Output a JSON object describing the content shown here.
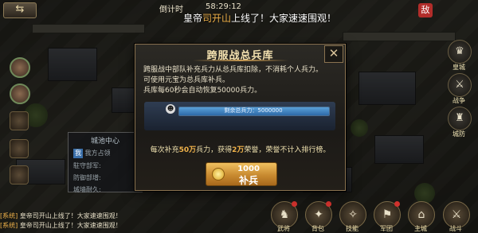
{
  "topbar": {
    "back_icon": "back-arrow-icon",
    "marquee_label": "倒计时",
    "time": "58:29:12",
    "marquee": {
      "prefix": "皇帝",
      "name": "司开山",
      "suffix": "上线了！大家速速围观！"
    },
    "enemy_badge": "敌"
  },
  "city_panel": {
    "title": "城池中心",
    "tag": "我",
    "row1": "我方占领",
    "row2": "駐守部军:",
    "row3": "防御部增:",
    "row4": "城墙耐久:"
  },
  "chat": [
    {
      "channel": "[系统]",
      "text": "皇帝司开山上线了！大家速速围观！"
    },
    {
      "channel": "[系统]",
      "text": "皇帝司开山上线了！大家速速围观！"
    }
  ],
  "right_menu": [
    {
      "icon": "crown-icon",
      "label": "皇城"
    },
    {
      "icon": "crossed-swords-icon",
      "label": "战争"
    },
    {
      "icon": "tower-icon",
      "label": "城防"
    }
  ],
  "bottom_nav": [
    {
      "icon": "general-icon",
      "label": "武将"
    },
    {
      "icon": "bag-icon",
      "label": "背包"
    },
    {
      "icon": "skill-icon",
      "label": "技能"
    },
    {
      "icon": "army-icon",
      "label": "军团"
    },
    {
      "icon": "city-icon",
      "label": "主城"
    },
    {
      "icon": "battle-icon",
      "label": "战斗"
    }
  ],
  "modal": {
    "title": "跨服战总兵库",
    "close_icon": "close-icon",
    "desc": [
      "跨服战中部队补充兵力从总兵库扣除，不消耗个人兵力。",
      "可使用元宝为总兵库补兵。",
      "兵库每60秒会自动恢复50000兵力。"
    ],
    "bar_icon": "soldier-icon",
    "bar_text": "剩余总兵力：5000000",
    "bar_fraction": 1.0,
    "note": {
      "p1": "每次补充",
      "v1": "50万",
      "p2": "兵力，获得",
      "v2": "2万",
      "p3": "荣誉，荣誉不计入排行榜。"
    },
    "refill_cost": "1000",
    "refill_label": "补兵",
    "gold_icon": "gold-coin-icon"
  },
  "colors": {
    "accent": "#f0b24a",
    "bar": "#3a7cc0",
    "frame": "#8a7350"
  }
}
